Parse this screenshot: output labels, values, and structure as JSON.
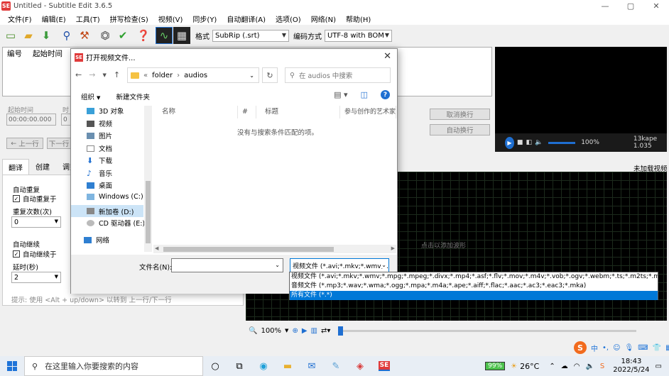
{
  "window": {
    "title": "Untitled - Subtitle Edit 3.6.5",
    "app_icon": "SE"
  },
  "menu": [
    "文件(F)",
    "编辑(E)",
    "工具(T)",
    "拼写检查(S)",
    "视频(V)",
    "同步(Y)",
    "自动翻译(A)",
    "选项(O)",
    "网络(N)",
    "帮助(H)"
  ],
  "toolbar": {
    "format_label": "格式",
    "format_value": "SubRip (.srt)",
    "encoding_label": "编码方式",
    "encoding_value": "UTF-8 with BOM"
  },
  "list": {
    "col_number": "编号",
    "col_start": "起始时间"
  },
  "edit": {
    "start_time_label": "起始时间",
    "duration_label": "时",
    "start_time_value": "00:00:00.000",
    "duration_value": "0",
    "prev_button": "上一行",
    "next_button": "下一行",
    "unbreak_button": "取消换行",
    "auto_break_button": "自动换行"
  },
  "tabs": [
    "翻译",
    "创建",
    "调整"
  ],
  "translate": {
    "auto_repeat_label": "自动重复",
    "auto_repeat_on": "自动重复于",
    "repeat_count_label": "重复次数(次)",
    "repeat_count_value": "0",
    "auto_continue_label": "自动继续",
    "auto_continue_on": "自动继续于",
    "delay_label": "延时(秒)",
    "delay_value": "2",
    "hint": "提示: 使用 <Alt + up/down> 以转到 上一行/下一行"
  },
  "video": {
    "not_loaded": "未加载视频",
    "time_left": "100%",
    "time_right": "13kape 1.035"
  },
  "waveform": {
    "hint": "点击以添加波形",
    "zoom": "100%"
  },
  "dialog": {
    "title": "打开视频文件...",
    "path": [
      "folder",
      "audios"
    ],
    "path_prefix": "«",
    "search_placeholder": "在 audios 中搜索",
    "organize": "组织",
    "new_folder": "新建文件夹",
    "tree": [
      "3D 对象",
      "视频",
      "图片",
      "文档",
      "下载",
      "音乐",
      "桌面",
      "Windows (C:)",
      "新加卷 (D:)",
      "CD 驱动器 (E:)",
      "网络"
    ],
    "columns": [
      "名称",
      "#",
      "标题",
      "参与创作的艺术家"
    ],
    "empty_message": "没有与搜索条件匹配的项。",
    "filename_label": "文件名(N):",
    "filetype_value": "视频文件 (*.avi;*.mkv;*.wmv;*."
  },
  "filetype_options": [
    "视频文件 (*.avi;*.mkv;*.wmv;*.mpg;*.mpeg;*.divx;*.mp4;*.asf;*.flv;*.mov;*.m4v;*.vob;*.ogv;*.webm;*.ts;*.m2ts;*.mts;*.avs;*.mxf)",
    "音频文件 (*.mp3;*.wav;*.wma;*.ogg;*.mpa;*.m4a;*.ape;*.aiff;*.flac;*.aac;*.ac3;*.eac3;*.mka)",
    "所有文件 (*.*)"
  ],
  "taskbar": {
    "search_placeholder": "在这里输入你要搜索的内容",
    "battery": "99%",
    "weather": "26°C",
    "time": "18:43",
    "date": "2022/5/24",
    "ime": "中"
  },
  "colors": {
    "accent": "#0078d7",
    "brand": "#e03a3a"
  }
}
